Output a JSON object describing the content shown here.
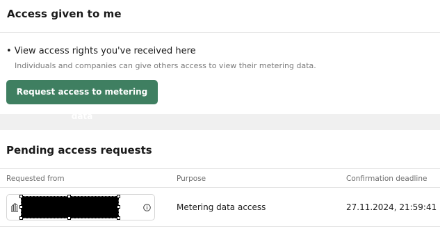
{
  "access_section": {
    "title": "Access given to me",
    "bullet": "• View access rights you've received here",
    "description": "Individuals and companies can give others access to view their metering data.",
    "request_button_label": "Request access to metering data"
  },
  "pending_section": {
    "title": "Pending access requests",
    "columns": {
      "requested_from": "Requested from",
      "purpose": "Purpose",
      "deadline": "Confirmation deadline"
    },
    "rows": [
      {
        "requested_from_icon": "bank-icon",
        "info_icon": "info-icon",
        "purpose": "Metering data access",
        "deadline": "27.11.2024, 21:59:41"
      }
    ]
  },
  "colors": {
    "primary": "#3f7f61",
    "background": "#f0f0f0"
  }
}
